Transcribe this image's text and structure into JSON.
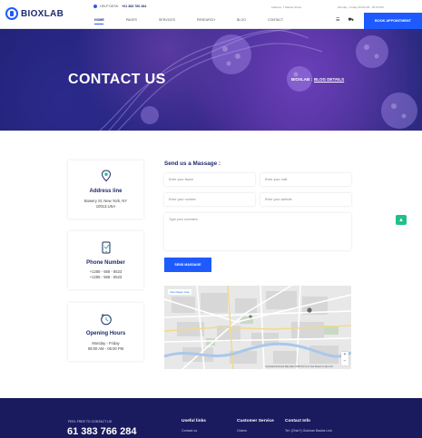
{
  "brand": {
    "name": "BIOXLAB"
  },
  "header": {
    "help_label": "HELP DESK:",
    "help_phone": "+61 383 766 284",
    "info_items": [
      "Address: 7 Market Street",
      "Monday - Friday 09:00 AM - 05:00 PM"
    ],
    "nav": [
      "HOME",
      "PAGES",
      "SERVICES",
      "RESEARCH",
      "BLOG",
      "CONTACT"
    ],
    "active_nav_index": 0,
    "cta": "BOOK APPOINTMENT"
  },
  "hero": {
    "title": "CONTACT US",
    "breadcrumb_root": "BIOXLAB :",
    "breadcrumb_current": "BLOG DETAILS"
  },
  "cards": [
    {
      "icon": "location-pin-icon",
      "title": "Address line",
      "lines": [
        "Bowery St, New York, NY",
        "10013,USA"
      ]
    },
    {
      "icon": "phone-icon",
      "title": "Phone Number",
      "lines": [
        "+1255 - 568 - 6523",
        "+1255 - 568 - 6523"
      ]
    },
    {
      "icon": "clock-icon",
      "title": "Opening Hours",
      "lines": [
        "Monday - Friday",
        "09:00 AM - 05:00 PM"
      ]
    }
  ],
  "form": {
    "title": "Send us a Massage :",
    "name_placeholder": "Enter your Name",
    "mail_placeholder": "Enter your mail",
    "number_placeholder": "Enter your number",
    "website_placeholder": "Enter your website",
    "comment_placeholder": "Type your comment",
    "submit_label": "SEND MASSAGE"
  },
  "map": {
    "link_label": "View larger map",
    "attribution": "Keyboard shortcuts   Map data ©2023   Terms of Use   Report a map error"
  },
  "footer": {
    "tagline": "FEEL FREE TO CONTACT US",
    "phone": "61 383 766 284",
    "col1_title": "Useful links",
    "col1_item": "Contact us",
    "col2_title": "Customer Service",
    "col2_item": "Orders",
    "col3_title": "Contact Info",
    "col3_item": "Tel: (Ohio?) Gulshan Badda Link"
  },
  "colors": {
    "primary": "#1e5bff",
    "navy": "#1f2a6b",
    "footer": "#1a1a5e",
    "accent_green": "#21c08b"
  }
}
